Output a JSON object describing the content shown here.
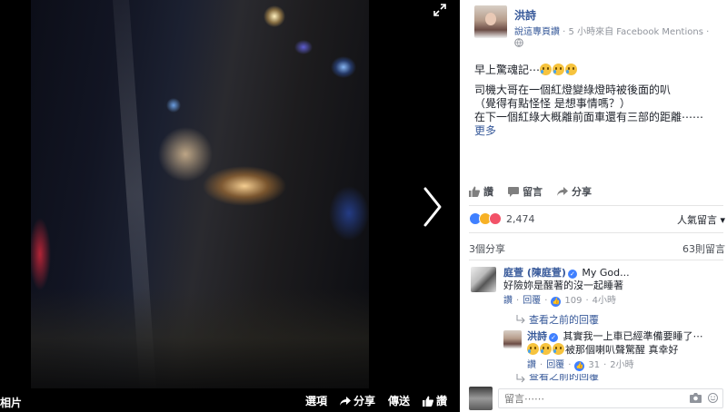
{
  "viewer": {
    "album_label": "相片",
    "actions": [
      {
        "label": "選項",
        "icon": "none"
      },
      {
        "label": "分享",
        "icon": "share-icon"
      },
      {
        "label": "傳送",
        "icon": "none"
      },
      {
        "label": "讚",
        "icon": "thumbs-up-icon"
      }
    ]
  },
  "post": {
    "author": "洪詩",
    "via": "說這專頁讚",
    "time_source": " · 5 小時來自 Facebook Mentions · ",
    "text_line1": "早上驚魂記⋯",
    "text_line2": "司機大哥在一個紅燈變綠燈時被後面的叭",
    "text_line3": "（覺得有點怪怪 是想事情嗎？）",
    "text_line4": "在下一個紅綠大概離前面車還有三部的距離⋯⋯",
    "more": "更多"
  },
  "actions": {
    "like": "讚",
    "comment": "留言",
    "share": "分享"
  },
  "reactions": {
    "count": "2,474",
    "sort": "人氣留言 ▾",
    "colors": [
      "#4080ff",
      "#f7b125",
      "#f25268"
    ]
  },
  "stats": {
    "shares": "3個分享",
    "comments": "63則留言"
  },
  "comments": [
    {
      "author": "庭萱 (陳庭萱)",
      "lead": "My God...",
      "text": "好險妳是醒著的沒一起睡著",
      "like": "讚",
      "reply": "回覆",
      "likes": "109",
      "time": "4小時"
    }
  ],
  "view_previous_1": "查看之前的回覆",
  "reply": {
    "author": "洪詩",
    "text": "其實我一上車已經準備要睡了⋯",
    "text2": "被那個喇叭聲驚醒 真幸好",
    "like": "讚",
    "reply": "回覆",
    "likes": "31",
    "time": "2小時"
  },
  "view_previous_2": "查看之前的回覆",
  "composer": {
    "placeholder": "留言⋯⋯"
  }
}
